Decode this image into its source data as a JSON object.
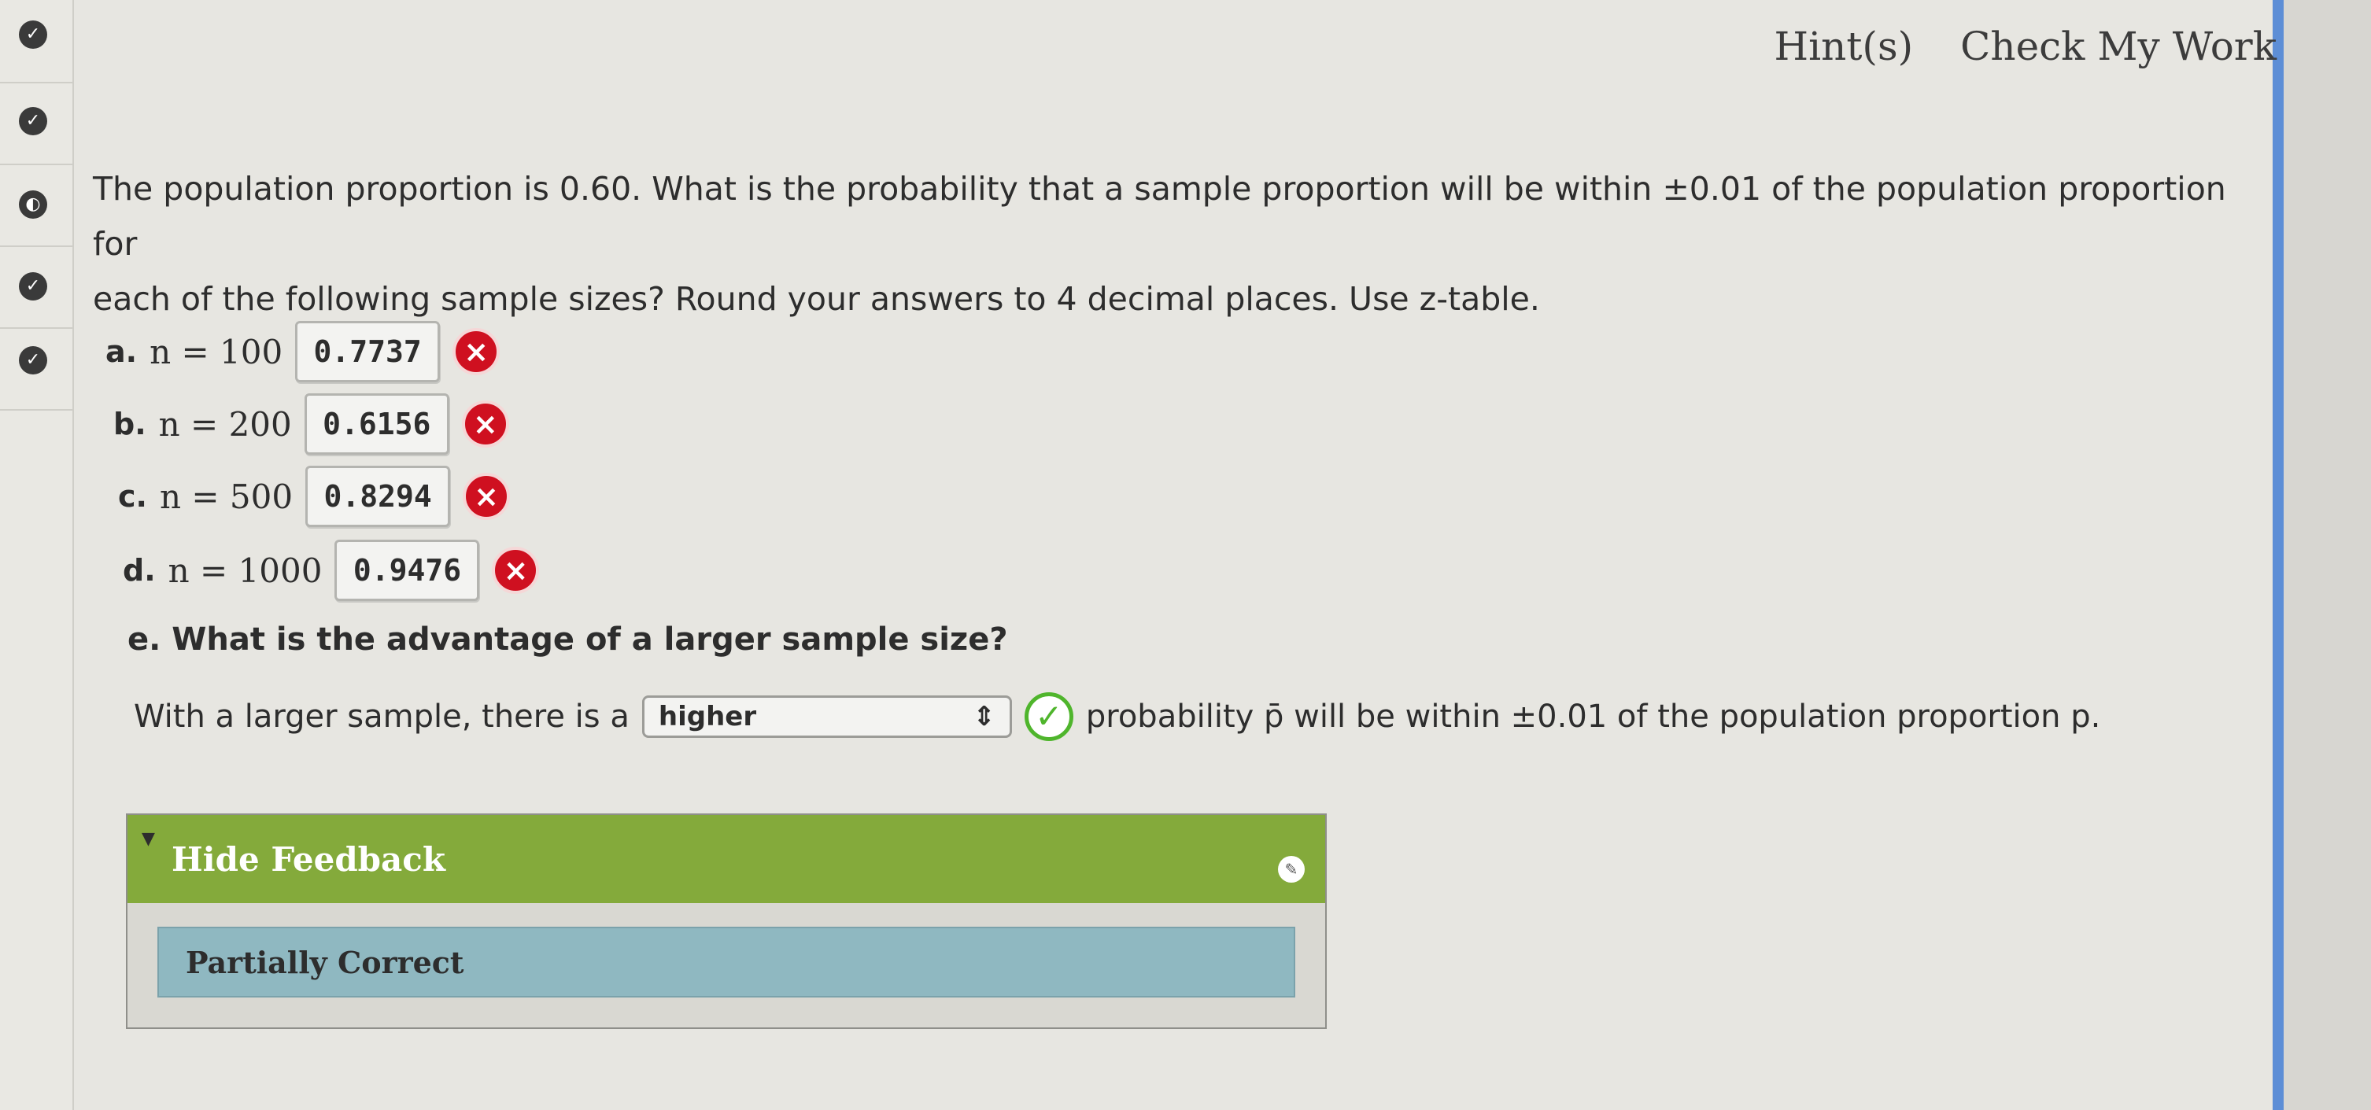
{
  "header": {
    "hints": "Hint(s)",
    "check": "Check My Work"
  },
  "question": {
    "line1": "The population proportion is 0.60. What is the probability that a sample proportion will be within ±0.01 of the population proportion for",
    "line2": "each of the following sample sizes? Round your answers to 4 decimal places. Use z-table."
  },
  "rows": [
    {
      "label": "a.",
      "n": "n = 100",
      "answer": "0.7737"
    },
    {
      "label": "b.",
      "n": "n = 200",
      "answer": "0.6156"
    },
    {
      "label": "c.",
      "n": "n = 500",
      "answer": "0.8294"
    },
    {
      "label": "d.",
      "n": "n = 1000",
      "answer": "0.9476"
    }
  ],
  "partE": {
    "question": "e. What is the advantage of a larger sample size?",
    "prefix": "With a larger sample, there is a",
    "select_value": "higher",
    "suffix": "probability p̄ will be within ±0.01 of the population proportion p."
  },
  "feedback": {
    "toggle": "Hide Feedback",
    "status": "Partially Correct"
  },
  "icons": {
    "wrong": "x-icon",
    "correct": "check-icon"
  }
}
